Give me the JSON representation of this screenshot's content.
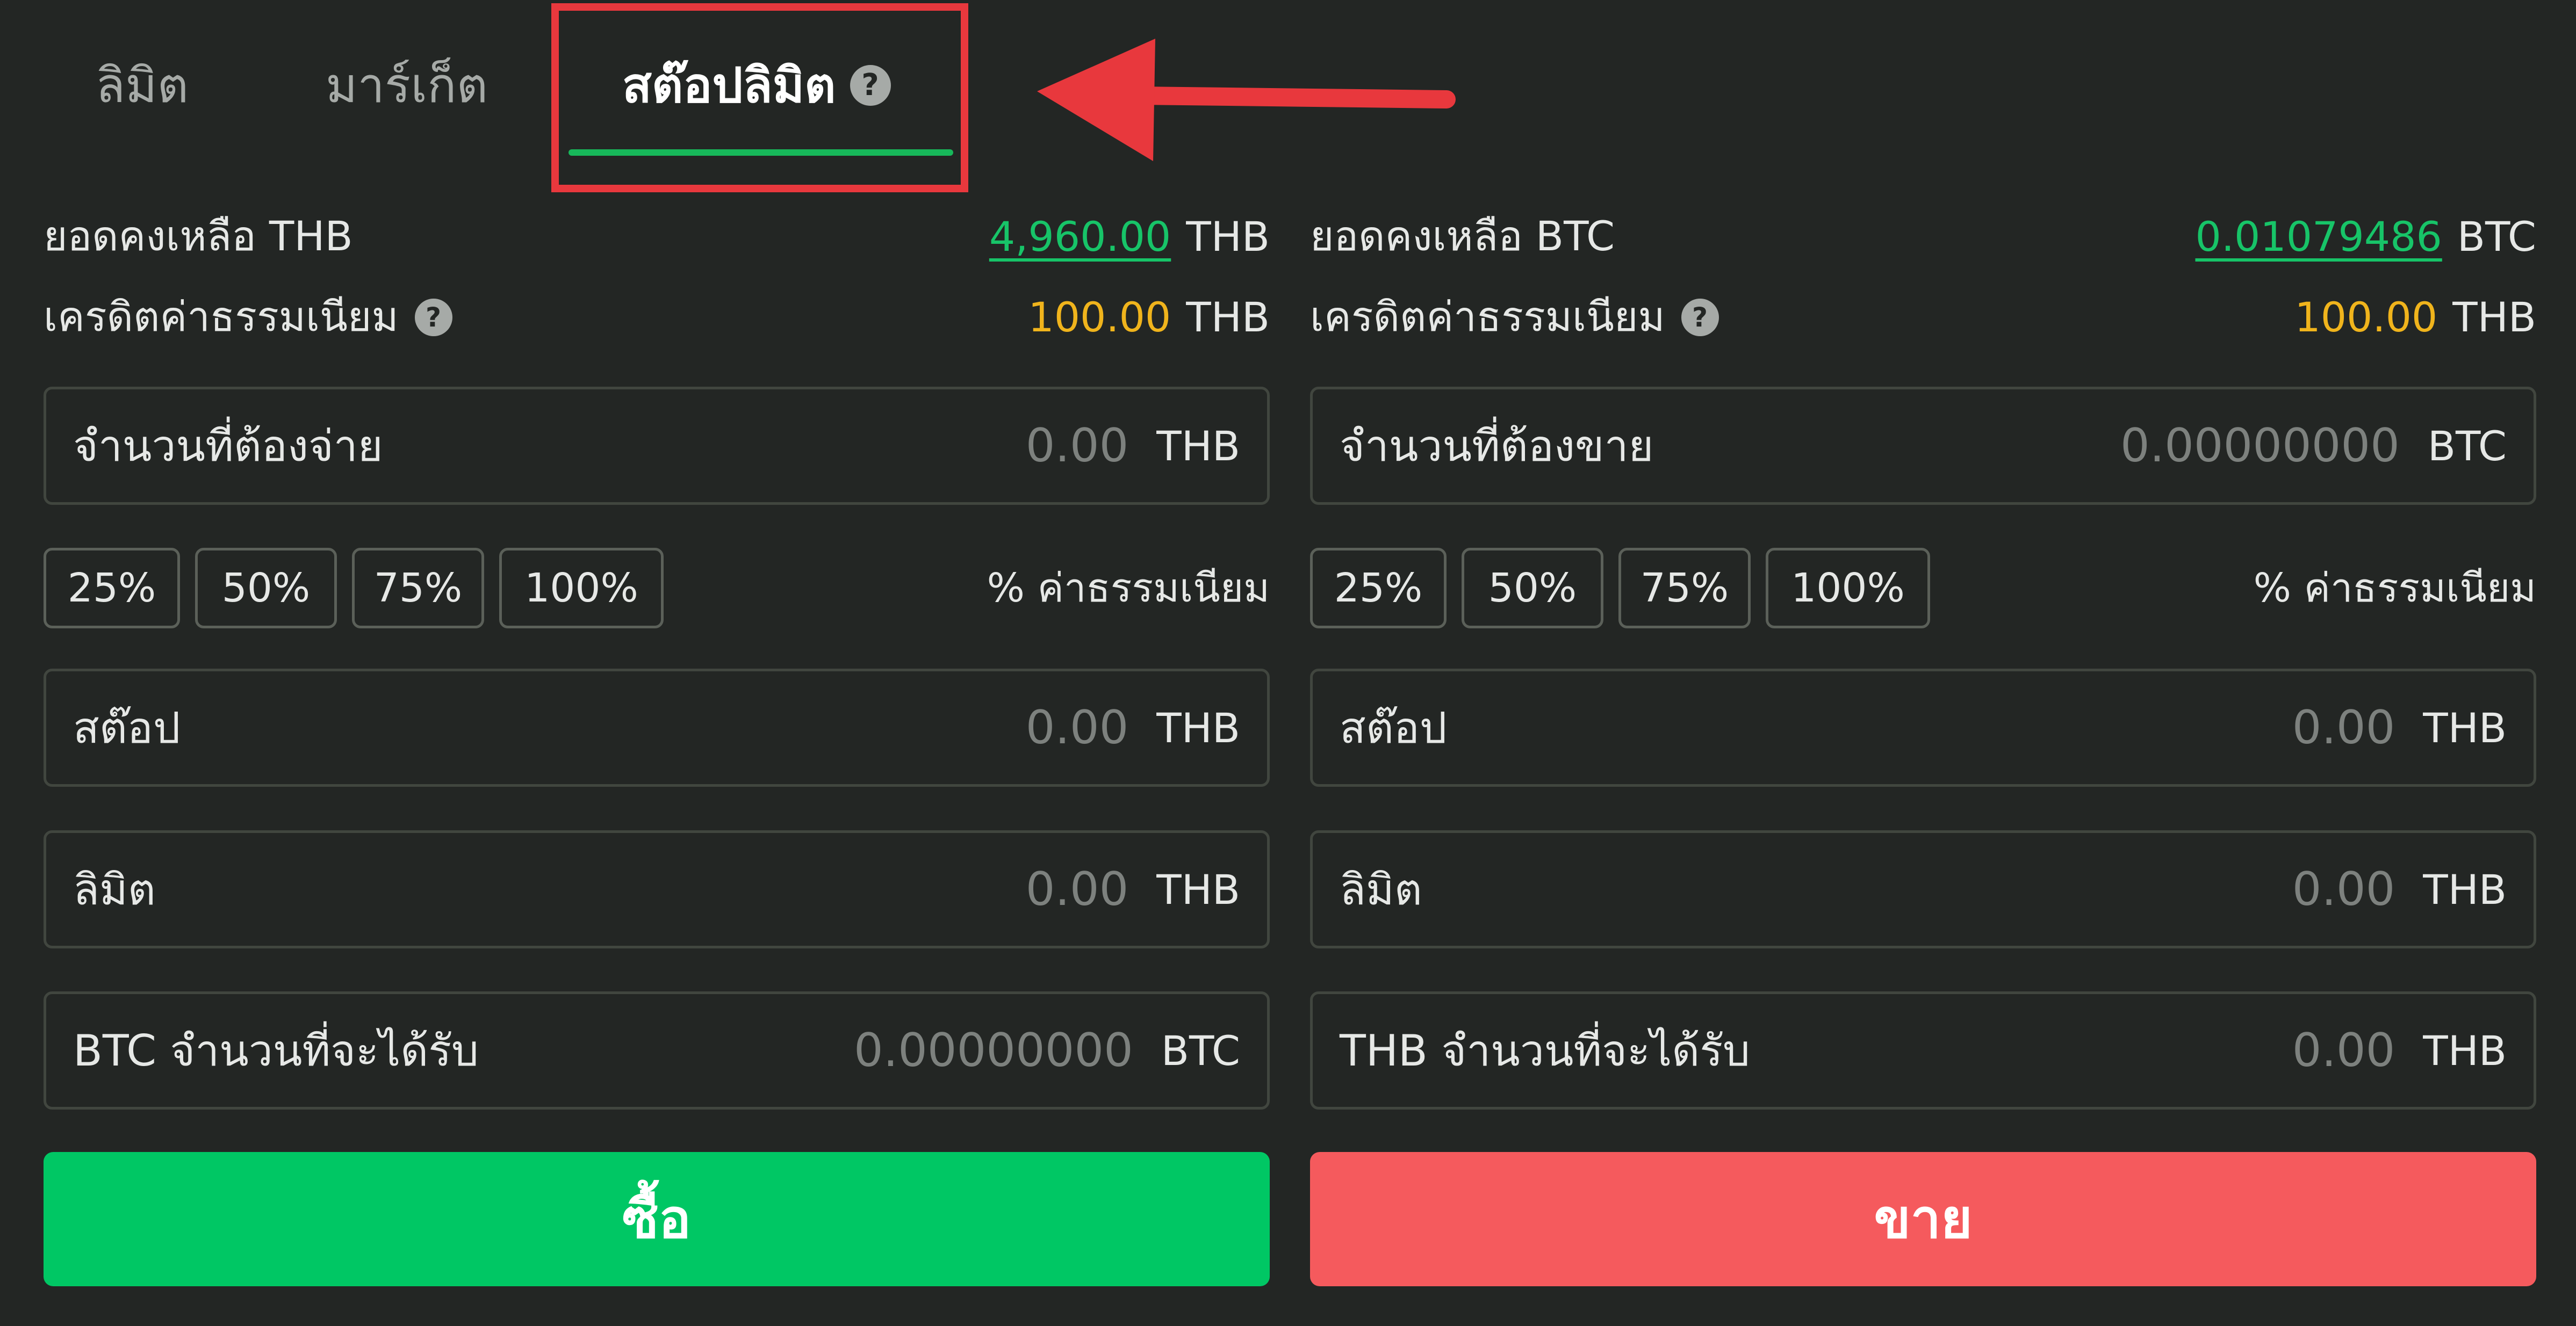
{
  "tabs": [
    {
      "label": "ลิมิต"
    },
    {
      "label": "มาร์เก็ต"
    },
    {
      "label": "สต๊อปลิมิต"
    }
  ],
  "help_glyph": "?",
  "colors": {
    "background": "#232624",
    "accent_green": "#17b85a",
    "highlight_red": "#e8383d",
    "buy": "#00c764",
    "sell": "#f55a5d",
    "fee_gold": "#f0b41c"
  },
  "buy": {
    "balance_label": "ยอดคงเหลือ THB",
    "balance_value": "4,960.00",
    "balance_unit": "THB",
    "fee_credit_label": "เครดิตค่าธรรมเนียม",
    "fee_credit_value": "100.00",
    "fee_credit_unit": "THB",
    "amount": {
      "label": "จำนวนที่ต้องจ่าย",
      "value": "0.00",
      "unit": "THB"
    },
    "percents": [
      "25%",
      "50%",
      "75%",
      "100%"
    ],
    "fee_percent_label": "% ค่าธรรมเนียม",
    "stop": {
      "label": "สต๊อป",
      "value": "0.00",
      "unit": "THB"
    },
    "limit": {
      "label": "ลิมิต",
      "value": "0.00",
      "unit": "THB"
    },
    "receive": {
      "label": "BTC จำนวนที่จะได้รับ",
      "value": "0.00000000",
      "unit": "BTC"
    },
    "button_label": "ซื้อ"
  },
  "sell": {
    "balance_label": "ยอดคงเหลือ BTC",
    "balance_value": "0.01079486",
    "balance_unit": "BTC",
    "fee_credit_label": "เครดิตค่าธรรมเนียม",
    "fee_credit_value": "100.00",
    "fee_credit_unit": "THB",
    "amount": {
      "label": "จำนวนที่ต้องขาย",
      "value": "0.00000000",
      "unit": "BTC"
    },
    "percents": [
      "25%",
      "50%",
      "75%",
      "100%"
    ],
    "fee_percent_label": "% ค่าธรรมเนียม",
    "stop": {
      "label": "สต๊อป",
      "value": "0.00",
      "unit": "THB"
    },
    "limit": {
      "label": "ลิมิต",
      "value": "0.00",
      "unit": "THB"
    },
    "receive": {
      "label": "THB จำนวนที่จะได้รับ",
      "value": "0.00",
      "unit": "THB"
    },
    "button_label": "ขาย"
  }
}
